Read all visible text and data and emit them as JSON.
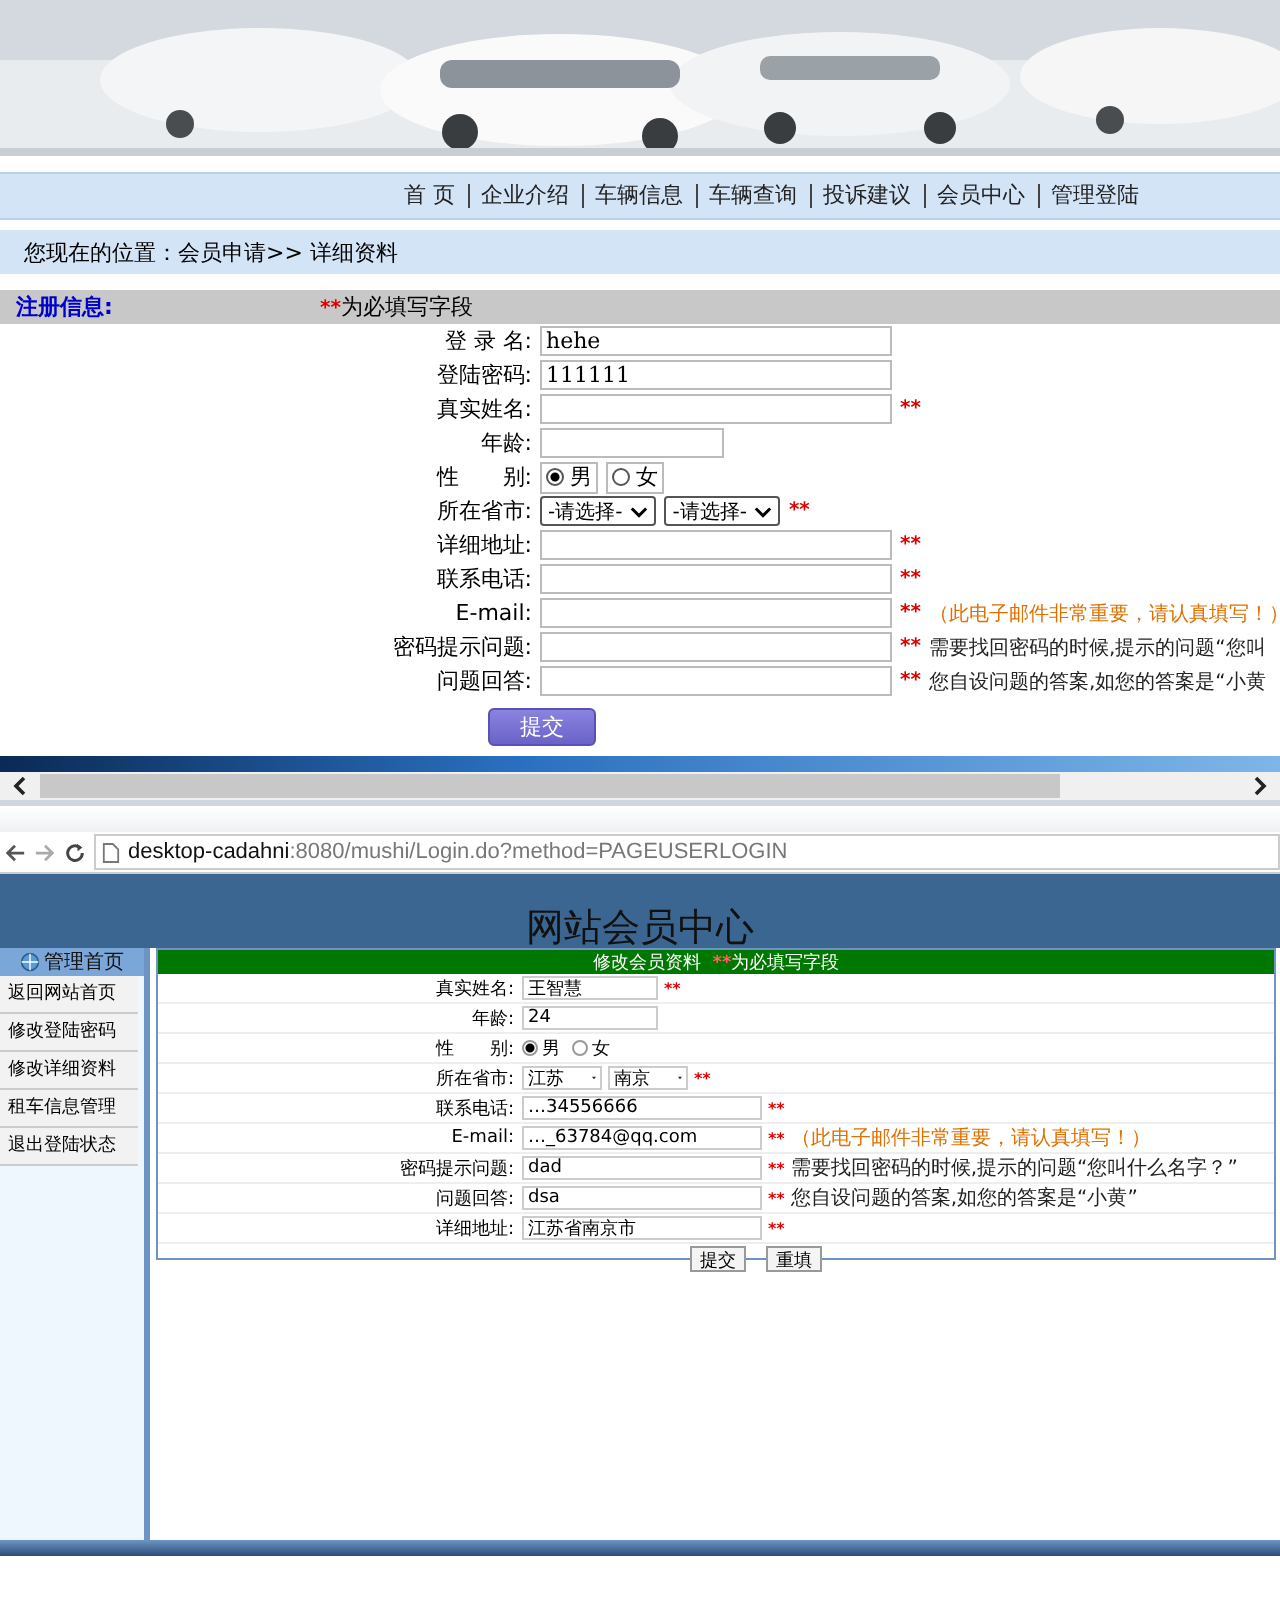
{
  "top_page": {
    "nav": [
      "首 页",
      "企业介绍",
      "车辆信息",
      "车辆查询",
      "投诉建议",
      "会员中心",
      "管理登陆"
    ],
    "breadcrumb": "您现在的位置：会员申请>> 详细资料",
    "register": {
      "title": "注册信息:",
      "required_mark": "**",
      "required_note": "为必填写字段",
      "fields": [
        {
          "label": "登 录 名:",
          "kind": "text",
          "value": "hehe"
        },
        {
          "label": "登陆密码:",
          "kind": "text",
          "value": "111111"
        },
        {
          "label": "真实姓名:",
          "kind": "text",
          "mark": "**"
        },
        {
          "label": "年龄:",
          "kind": "short"
        },
        {
          "label": "性　　别:",
          "kind": "radio",
          "options": [
            {
              "label": "男",
              "selected": true
            },
            {
              "label": "女",
              "selected": false
            }
          ]
        },
        {
          "label": "所在省市:",
          "kind": "select",
          "options": [
            "-请选择-",
            "-请选择-"
          ],
          "mark": "**"
        },
        {
          "label": "详细地址:",
          "kind": "text",
          "mark": "**"
        },
        {
          "label": "联系电话:",
          "kind": "text",
          "mark": "**"
        },
        {
          "label": "E-mail:",
          "kind": "text",
          "mark": "**",
          "note": "（此电子邮件非常重要，请认真填写！）",
          "note_emphasized": true
        },
        {
          "label": "密码提示问题:",
          "kind": "text",
          "mark": "**",
          "note": "需要找回密码的时候,提示的问题“您叫",
          "note_emphasized": false
        },
        {
          "label": "问题回答:",
          "kind": "text",
          "mark": "**",
          "note": "您自设问题的答案,如您的答案是“小黄",
          "note_emphasized": false
        }
      ],
      "submit": "提交"
    }
  },
  "browser": {
    "url_host": "desktop-cadahni",
    "url_rest": ":8080/mushi/Login.do?method=PAGEUSERLOGIN"
  },
  "member_center": {
    "title": "网站会员中心",
    "sidebar": {
      "title": "管理首页",
      "items": [
        "返回网站首页",
        "修改登陆密码",
        "修改详细资料",
        "租车信息管理",
        "退出登陆状态"
      ]
    },
    "form": {
      "title": "修改会员资料",
      "required_mark": "**",
      "required_note": "为必填写字段",
      "fields": [
        {
          "label": "真实姓名:",
          "kind": "short",
          "value": "王智慧",
          "mark": "**"
        },
        {
          "label": "年龄:",
          "kind": "short",
          "value": "24"
        },
        {
          "label": "性　　别:",
          "kind": "radio",
          "options": [
            {
              "label": "男",
              "selected": true
            },
            {
              "label": "女",
              "selected": false
            }
          ]
        },
        {
          "label": "所在省市:",
          "kind": "select",
          "options": [
            "江苏",
            "南京"
          ],
          "mark": "**"
        },
        {
          "label": "联系电话:",
          "kind": "text",
          "value": "…34556666",
          "mark": "**"
        },
        {
          "label": "E-mail:",
          "kind": "text",
          "value": "…_63784@qq.com",
          "mark": "**",
          "note": "（此电子邮件非常重要，请认真填写！）",
          "note_emphasized": true
        },
        {
          "label": "密码提示问题:",
          "kind": "text",
          "value": "dad",
          "mark": "**",
          "note": "需要找回密码的时候,提示的问题“您叫什么名字？”",
          "note_emphasized": false
        },
        {
          "label": "问题回答:",
          "kind": "text",
          "value": "dsa",
          "mark": "**",
          "note": "您自设问题的答案,如您的答案是“小黄”",
          "note_emphasized": false
        },
        {
          "label": "详细地址:",
          "kind": "text",
          "value": "江苏省南京市",
          "mark": "**"
        }
      ],
      "buttons": [
        "提交",
        "重填"
      ]
    }
  }
}
